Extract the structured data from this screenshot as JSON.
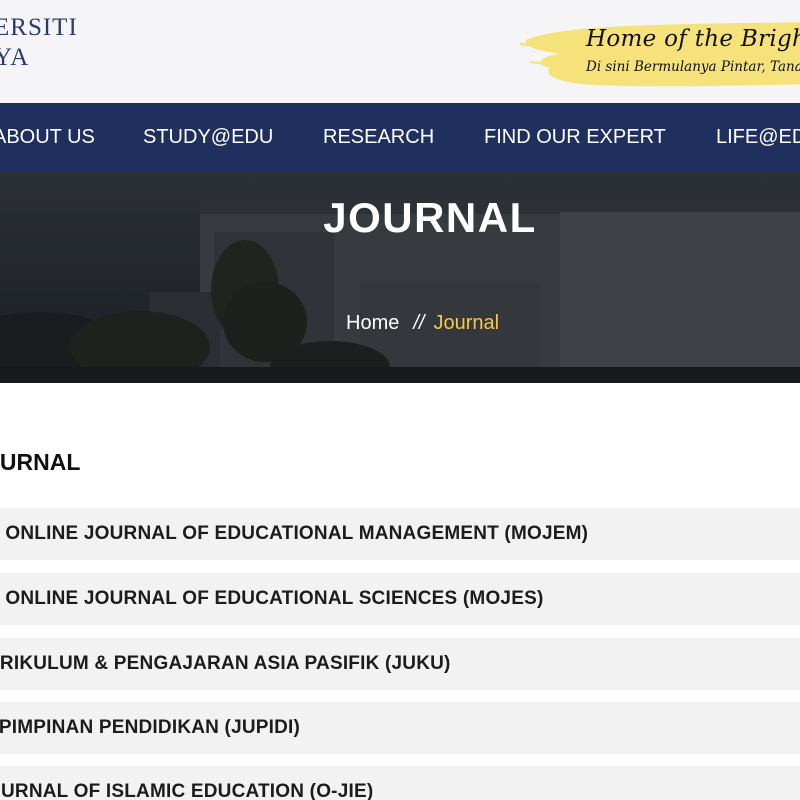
{
  "header": {
    "logo_line1": "ERSITI",
    "logo_line2": "YA",
    "slogan_line1": "Home of the Bright, La",
    "slogan_line2": "Di sini Bermulanya Pintar, Tana"
  },
  "nav": {
    "items": [
      "ABOUT US",
      "STUDY@EDU",
      "RESEARCH",
      "FIND OUR EXPERT",
      "LIFE@ED"
    ]
  },
  "hero": {
    "title": "JOURNAL",
    "breadcrumb": {
      "home": "Home",
      "separator": "//",
      "current": "Journal"
    }
  },
  "main": {
    "section_title": "OURNAL",
    "journals": [
      "N ONLINE JOURNAL OF EDUCATIONAL MANAGEMENT (MOJEM)",
      "N ONLINE JOURNAL OF EDUCATIONAL SCIENCES (MOJES)",
      "URIKULUM & PENGAJARAN ASIA PASIFIK (JUKU)",
      "EPIMPINAN PENDIDIKAN (JUPIDI)",
      "OURNAL OF ISLAMIC EDUCATION (O-JIE)"
    ]
  },
  "colors": {
    "nav_bg": "#1f2f5e",
    "breadcrumb_current": "#f2c94c",
    "logo": "#2b3a72",
    "slogan_highlight": "#f6e27a"
  }
}
